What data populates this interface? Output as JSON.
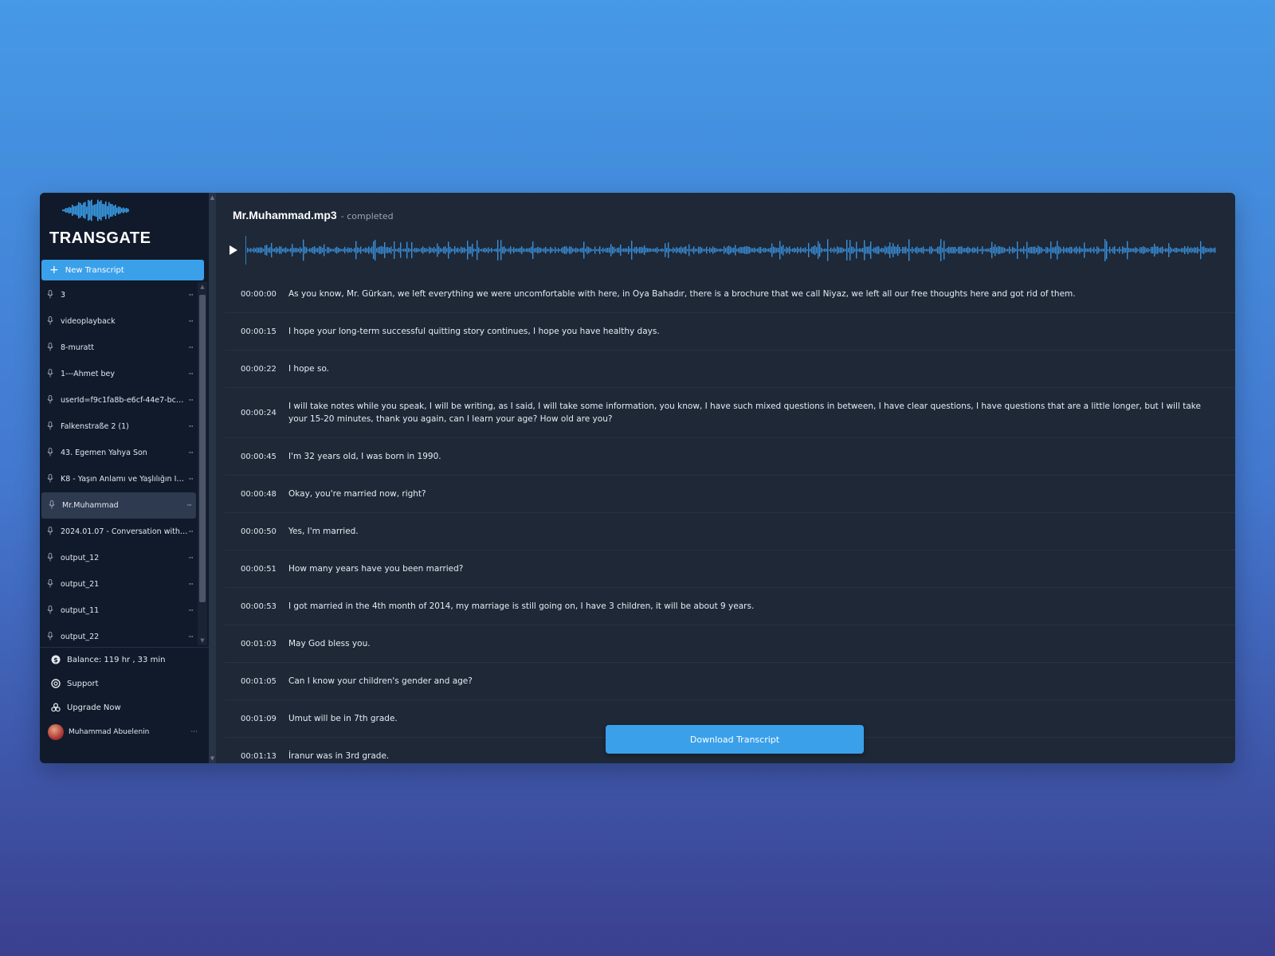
{
  "brand": {
    "name": "TRANSGATE"
  },
  "sidebar": {
    "new_button": "New Transcript",
    "files": [
      {
        "name": "3"
      },
      {
        "name": "videoplayback"
      },
      {
        "name": "8-muratt"
      },
      {
        "name": "1---Ahmet bey"
      },
      {
        "name": "userId=f9c1fa8b-e6cf-44e7-bc1f-18..."
      },
      {
        "name": "Falkenstraße 2 (1)"
      },
      {
        "name": "43. Egemen Yahya Son"
      },
      {
        "name": "K8 - Yaşın Anlamı ve Yaşlılığın İnşa..."
      },
      {
        "name": "Mr.Muhammad",
        "active": true
      },
      {
        "name": "2024.01.07 - Conversation with me, ..."
      },
      {
        "name": "output_12"
      },
      {
        "name": "output_21"
      },
      {
        "name": "output_11"
      },
      {
        "name": "output_22"
      }
    ],
    "balance": "Balance: 119 hr , 33 min",
    "support": "Support",
    "upgrade": "Upgrade Now",
    "user": "Muhammad Abuelenin"
  },
  "main": {
    "file_name": "Mr.Muhammad.mp3",
    "status": "- completed",
    "segments": [
      {
        "time": "00:00:00",
        "text": "As you know, Mr. Gürkan, we left everything we were uncomfortable with here, in Oya Bahadır, there is a brochure that we call Niyaz, we left all our free thoughts here and got rid of them."
      },
      {
        "time": "00:00:15",
        "text": "I hope your long-term successful quitting story continues, I hope you have healthy days."
      },
      {
        "time": "00:00:22",
        "text": "I hope so."
      },
      {
        "time": "00:00:24",
        "text": "I will take notes while you speak, I will be writing, as I said, I will take some information, you know, I have such mixed questions in between, I have clear questions, I have questions that are a little longer, but I will take your 15-20 minutes, thank you again, can I learn your age? How old are you?"
      },
      {
        "time": "00:00:45",
        "text": "I'm 32 years old, I was born in 1990."
      },
      {
        "time": "00:00:48",
        "text": "Okay, you're married now, right?"
      },
      {
        "time": "00:00:50",
        "text": "Yes, I'm married."
      },
      {
        "time": "00:00:51",
        "text": "How many years have you been married?"
      },
      {
        "time": "00:00:53",
        "text": "I got married in the 4th month of 2014, my marriage is still going on, I have 3 children, it will be about 9 years."
      },
      {
        "time": "00:01:03",
        "text": "May God bless you."
      },
      {
        "time": "00:01:05",
        "text": "Can I know your children's gender and age?"
      },
      {
        "time": "00:01:09",
        "text": "Umut will be in 7th grade."
      },
      {
        "time": "00:01:13",
        "text": "İranur was in 3rd grade."
      }
    ],
    "download_button": "Download Transcript"
  },
  "colors": {
    "accent": "#3aa0ea",
    "panel": "#1e2837",
    "sidebar": "#111a2b"
  }
}
